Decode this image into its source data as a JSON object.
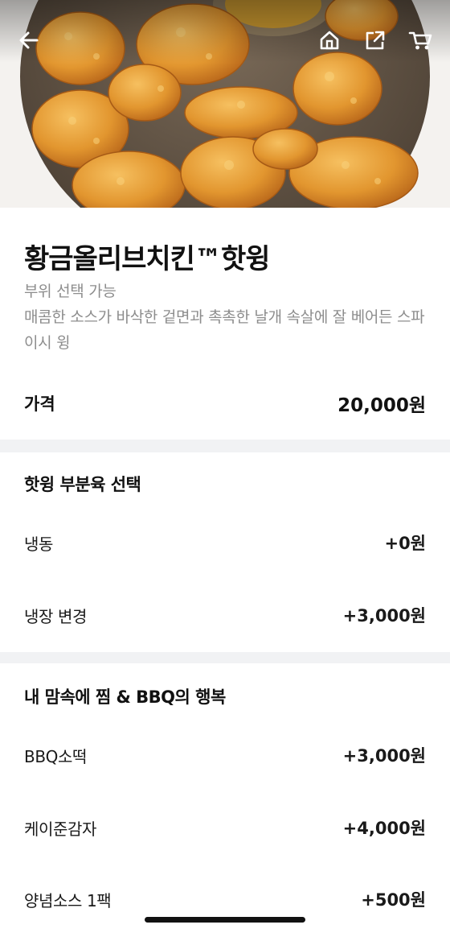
{
  "header": {
    "icons": [
      "back-arrow-icon",
      "home-icon",
      "share-icon",
      "cart-icon"
    ]
  },
  "product": {
    "title": "황금올리브치킨™핫윙",
    "description": "부위 선택 가능\n매콤한 소스가 바삭한 겉면과 촉촉한 날개 속살에 잘 베어든 스파이시 윙",
    "price_label": "가격",
    "price": "20,000원"
  },
  "option_groups": [
    {
      "title": "핫윙 부분육 선택",
      "options": [
        {
          "name": "냉동",
          "price": "+0원"
        },
        {
          "name": "냉장 변경",
          "price": "+3,000원"
        }
      ]
    },
    {
      "title": "내 맘속에 찜 & BBQ의 행복",
      "options": [
        {
          "name": "BBQ소떡",
          "price": "+3,000원"
        },
        {
          "name": "케이준감자",
          "price": "+4,000원"
        },
        {
          "name": "양념소스 1팩",
          "price": "+500원"
        }
      ]
    }
  ],
  "colors": {
    "text_primary": "#111111",
    "text_secondary": "#8d8d8d",
    "divider": "#f1f2f4",
    "chicken": "#e09a3a"
  }
}
